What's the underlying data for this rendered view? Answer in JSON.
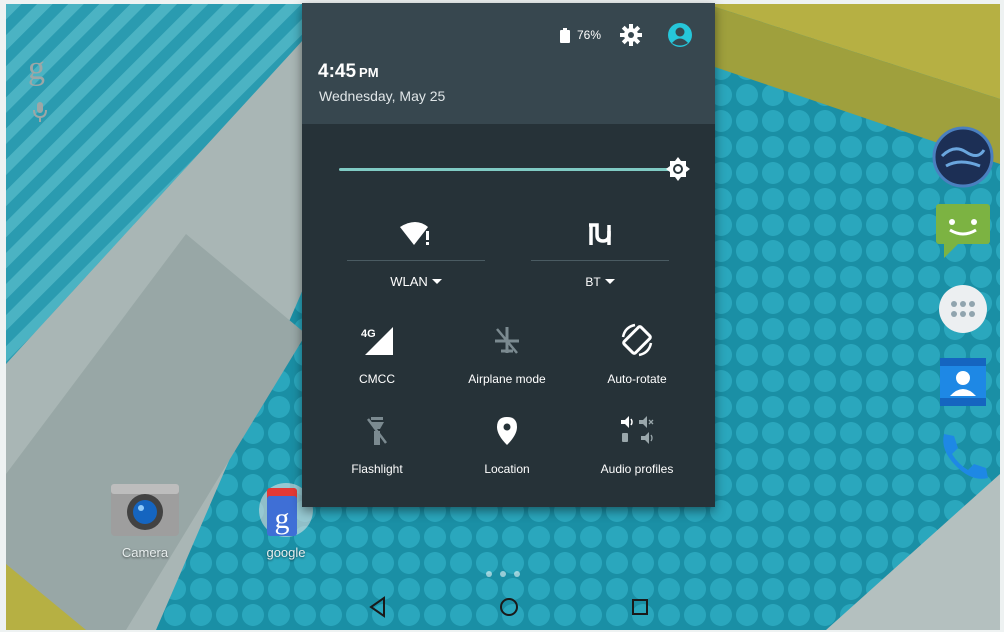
{
  "status": {
    "battery": "76%"
  },
  "clock": {
    "time": "4:45",
    "ampm": "PM",
    "date": "Wednesday, May 25"
  },
  "brightness": {
    "level": 1.0
  },
  "quick_settings": {
    "wlan_label": "WLAN",
    "bt_label": "BT",
    "tiles": [
      {
        "label": "CMCC",
        "icon": "signal-4g-icon"
      },
      {
        "label": "Airplane mode",
        "icon": "airplane-icon"
      },
      {
        "label": "Auto-rotate",
        "icon": "rotate-icon"
      },
      {
        "label": "Flashlight",
        "icon": "flashlight-icon"
      },
      {
        "label": "Location",
        "icon": "location-pin-icon"
      },
      {
        "label": "Audio profiles",
        "icon": "audio-profiles-icon"
      }
    ]
  },
  "home": {
    "apps": [
      {
        "label": "Camera",
        "icon": "camera-icon"
      },
      {
        "label": "google",
        "icon": "google-folder-icon"
      }
    ],
    "dock": [
      "browser-globe-icon",
      "messaging-icon",
      "app-drawer-icon",
      "contacts-icon",
      "phone-icon"
    ]
  },
  "colors": {
    "shade_bg": "#263238",
    "header_bg": "#37474f",
    "accent": "#80cbc4",
    "user_icon": "#26c6da"
  }
}
